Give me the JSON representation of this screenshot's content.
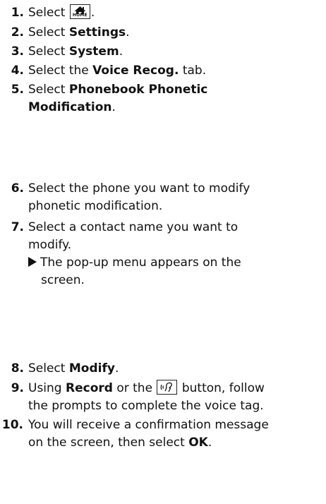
{
  "steps": [
    {
      "num": "1.",
      "pre": "Select ",
      "icon": "home-icon",
      "icon_label": "HOME",
      "post": "."
    },
    {
      "num": "2.",
      "pre": "Select ",
      "bold": "Settings",
      "post": "."
    },
    {
      "num": "3.",
      "pre": "Select ",
      "bold": "System",
      "post": "."
    },
    {
      "num": "4.",
      "pre": "Select the ",
      "bold": "Voice Recog.",
      "post": " tab."
    },
    {
      "num": "5.",
      "pre": "Select ",
      "bold_line1": "Phonebook Phonetic",
      "bold_line2": "Modification",
      "post": "."
    },
    {
      "num": "6.",
      "line1": "Select the phone you want to modify",
      "line2": "phonetic modification."
    },
    {
      "num": "7.",
      "line1": "Select a contact name you want to",
      "line2": "modify.",
      "result_line1": "The pop-up menu appears on the",
      "result_line2": "screen."
    },
    {
      "num": "8.",
      "pre": "Select ",
      "bold": "Modify",
      "post": "."
    },
    {
      "num": "9.",
      "pre": "Using ",
      "bold": "Record",
      "mid": " or the ",
      "icon": "talk-icon",
      "post": " button, follow",
      "line2": "the prompts to complete the voice tag."
    },
    {
      "num": "10.",
      "line1": "You will receive a confirmation message",
      "pre2": "on the screen, then select ",
      "bold2": "OK",
      "post2": "."
    }
  ]
}
